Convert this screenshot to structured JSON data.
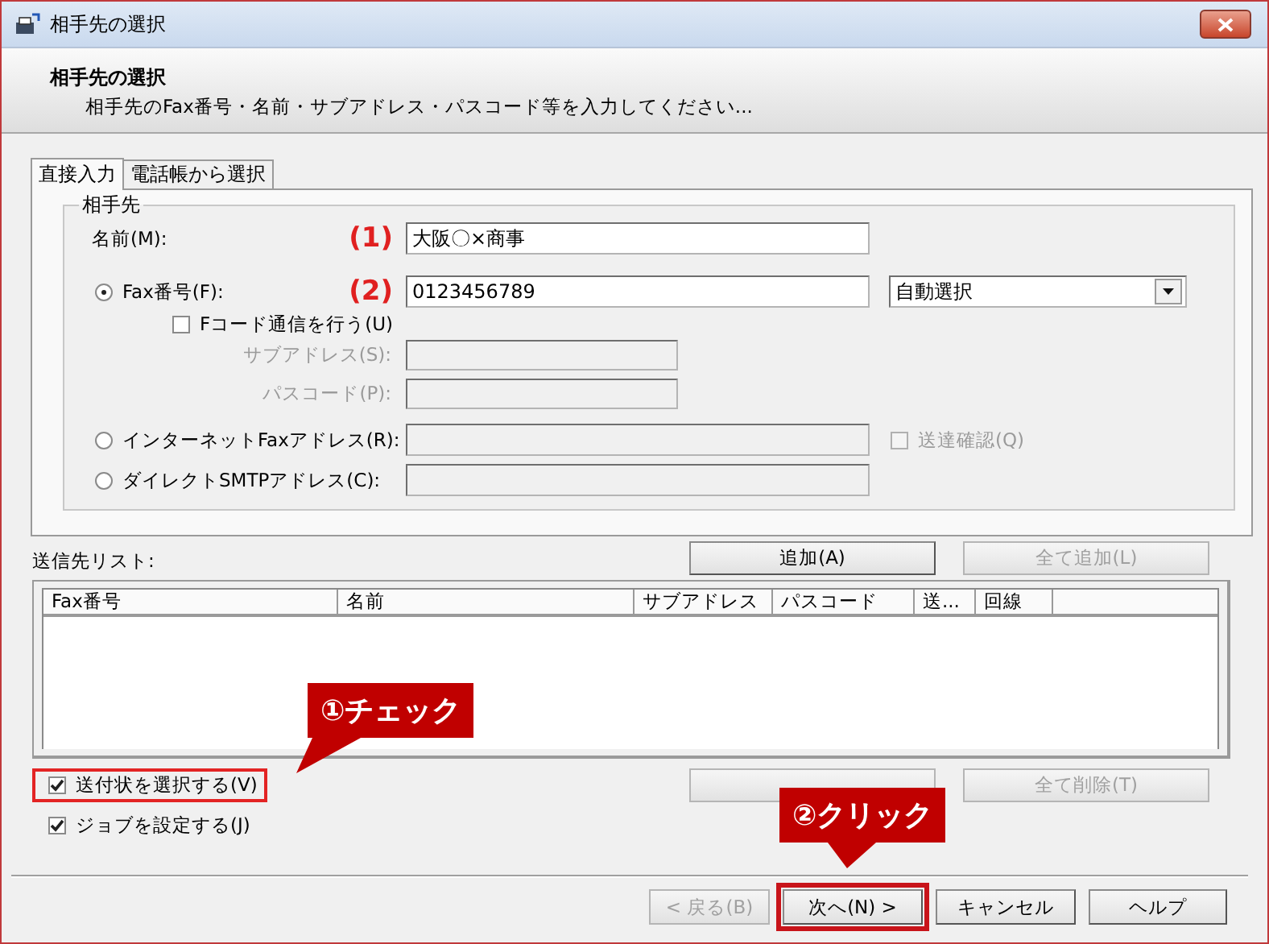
{
  "window": {
    "title": "相手先の選択"
  },
  "header": {
    "title": "相手先の選択",
    "subtitle": "相手先のFax番号・名前・サブアドレス・パスコード等を入力してください..."
  },
  "tabs": [
    {
      "label": "直接入力",
      "selected": true
    },
    {
      "label": "電話帳から選択",
      "selected": false
    }
  ],
  "group": {
    "title": "相手先",
    "rows": [
      {
        "kind": "text",
        "label": "名前(M):",
        "marker": "(1)",
        "value": "大阪〇×商事"
      },
      {
        "kind": "radio",
        "label": "Fax番号(F):",
        "selected": true,
        "marker": "(2)",
        "value": "0123456789",
        "combo": "自動選択",
        "disabled": false
      },
      {
        "kind": "check",
        "label": "Fコード通信を行う(U)",
        "checked": false
      },
      {
        "kind": "sub",
        "label": "サブアドレス(S):",
        "disabled": true
      },
      {
        "kind": "sub",
        "label": "パスコード(P):",
        "disabled": true
      },
      {
        "kind": "radio",
        "label": "インターネットFaxアドレス(R):",
        "selected": false,
        "disabled": true,
        "check": {
          "label": "送達確認(Q)",
          "checked": false,
          "disabled": true
        }
      },
      {
        "kind": "radio",
        "label": "ダイレクトSMTPアドレス(C):",
        "selected": false,
        "disabled": true
      }
    ]
  },
  "list": {
    "label": "送信先リスト:",
    "columns": [
      "Fax番号",
      "名前",
      "サブアドレス",
      "パスコード",
      "送...",
      "回線"
    ]
  },
  "list_buttons": [
    {
      "label": "追加(A)",
      "disabled": false
    },
    {
      "label": "全て追加(L)",
      "disabled": true
    }
  ],
  "remove_buttons": [
    {
      "disabled": true
    },
    {
      "label": "全て削除(T)",
      "disabled": true
    }
  ],
  "options": [
    {
      "label": "送付状を選択する(V)",
      "checked": true,
      "highlighted": true
    },
    {
      "label": "ジョブを設定する(J)",
      "checked": true,
      "highlighted": false
    }
  ],
  "buttons": [
    {
      "label": "< 戻る(B)",
      "disabled": true,
      "highlighted": false
    },
    {
      "label": "次へ(N) >",
      "disabled": false,
      "highlighted": true
    },
    {
      "label": "キャンセル",
      "disabled": false,
      "highlighted": false
    },
    {
      "label": "ヘルプ",
      "disabled": false,
      "highlighted": false
    }
  ],
  "callouts": [
    {
      "text": "①チェック"
    },
    {
      "text": "②クリック"
    }
  ]
}
